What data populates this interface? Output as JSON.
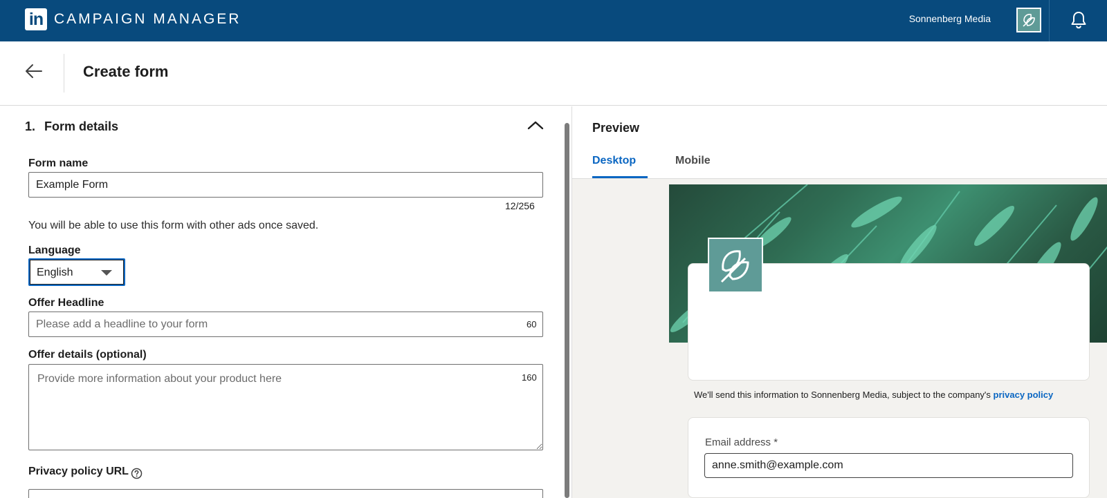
{
  "topbar": {
    "logo_text": "in",
    "app_title": "CAMPAIGN MANAGER",
    "account_name": "Sonnenberg Media",
    "brand_color": "#084a7d"
  },
  "header": {
    "title": "Create form"
  },
  "form": {
    "section_number": "1.",
    "section_title": "Form details",
    "form_name_label": "Form name",
    "form_name_value": "Example Form",
    "form_name_counter": "12/256",
    "reuse_note": "You will be able to use this form with other ads once saved.",
    "language_label": "Language",
    "language_value": "English",
    "headline_label": "Offer Headline",
    "headline_placeholder": "Please add a headline to your form",
    "headline_counter": "60",
    "details_label": "Offer details (optional)",
    "details_placeholder": "Provide more information about your product here",
    "details_counter": "160",
    "privacy_label": "Privacy policy URL"
  },
  "preview": {
    "title": "Preview",
    "tabs": [
      {
        "label": "Desktop",
        "active": true
      },
      {
        "label": "Mobile",
        "active": false
      }
    ],
    "consent_text": "We'll send this information to Sonnenberg Media, subject to the company's ",
    "consent_link": "privacy policy",
    "email_label": "Email address *",
    "email_value": "anne.smith@example.com",
    "accent_color": "#0a66c2",
    "logo_color": "#5f9b97"
  }
}
